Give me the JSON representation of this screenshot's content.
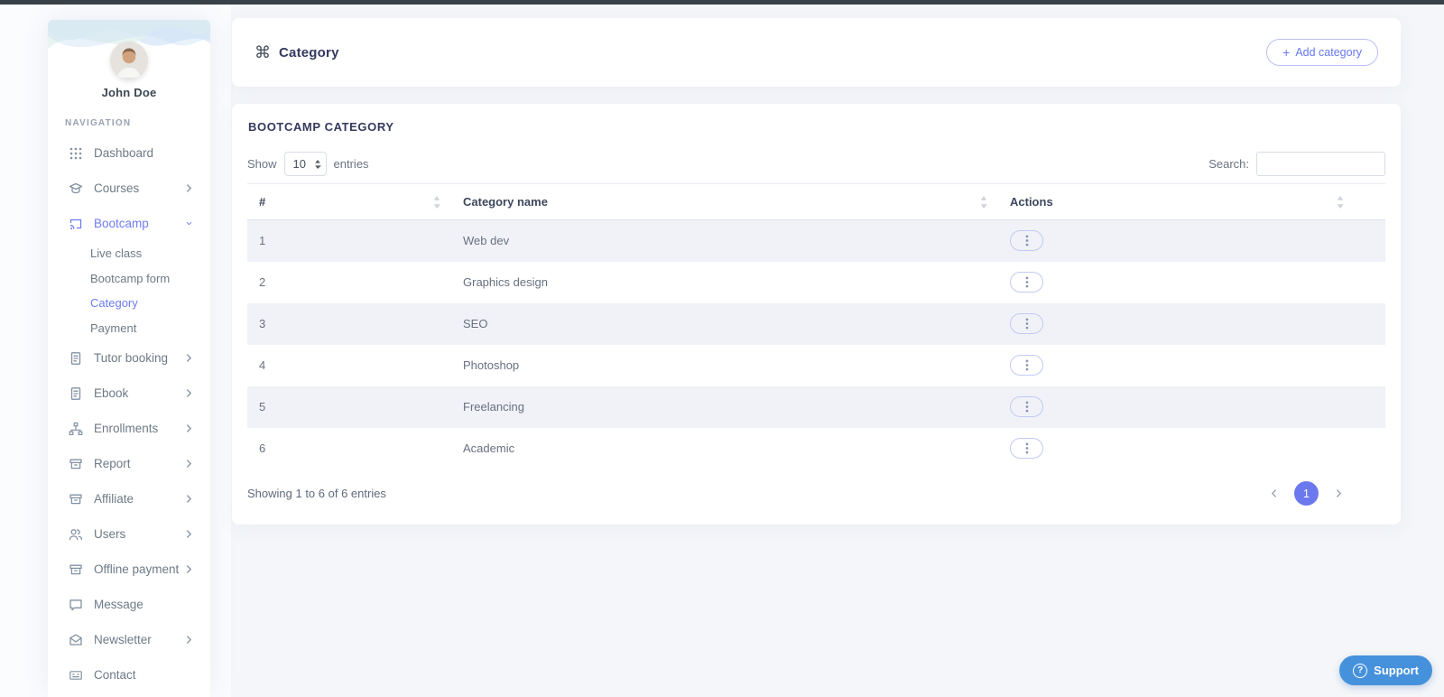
{
  "sidebar": {
    "user_name": "John Doe",
    "section_label": "NAVIGATION",
    "items": [
      {
        "label": "Dashboard",
        "icon": "grid-icon",
        "chevron": "none"
      },
      {
        "label": "Courses",
        "icon": "courses-icon",
        "chevron": "right"
      },
      {
        "label": "Bootcamp",
        "icon": "cast-icon",
        "chevron": "down",
        "active": true,
        "children": [
          {
            "label": "Live class"
          },
          {
            "label": "Bootcamp form"
          },
          {
            "label": "Category",
            "active": true
          },
          {
            "label": "Payment"
          }
        ]
      },
      {
        "label": "Tutor booking",
        "icon": "file-icon",
        "chevron": "right"
      },
      {
        "label": "Ebook",
        "icon": "file-icon",
        "chevron": "right"
      },
      {
        "label": "Enrollments",
        "icon": "sitemap-icon",
        "chevron": "right"
      },
      {
        "label": "Report",
        "icon": "tray-icon",
        "chevron": "right"
      },
      {
        "label": "Affiliate",
        "icon": "tray-icon",
        "chevron": "right"
      },
      {
        "label": "Users",
        "icon": "users-icon",
        "chevron": "right"
      },
      {
        "label": "Offline payment",
        "icon": "tray-icon",
        "chevron": "right"
      },
      {
        "label": "Message",
        "icon": "chat-icon",
        "chevron": "none"
      },
      {
        "label": "Newsletter",
        "icon": "envelope-icon",
        "chevron": "right"
      },
      {
        "label": "Contact",
        "icon": "idcard-icon",
        "chevron": "none"
      }
    ]
  },
  "header": {
    "icon": "command-icon",
    "title": "Category",
    "add_button_label": "Add category",
    "add_button_plus": "+"
  },
  "panel": {
    "title": "BOOTCAMP CATEGORY",
    "length_control": {
      "show_label": "Show",
      "value": "10",
      "entries_label": "entries"
    },
    "search": {
      "label": "Search:",
      "value": ""
    },
    "table": {
      "columns": [
        "#",
        "Category name",
        "Actions"
      ],
      "rows": [
        {
          "num": "1",
          "name": "Web dev"
        },
        {
          "num": "2",
          "name": "Graphics design"
        },
        {
          "num": "3",
          "name": "SEO"
        },
        {
          "num": "4",
          "name": "Photoshop"
        },
        {
          "num": "5",
          "name": "Freelancing"
        },
        {
          "num": "6",
          "name": "Academic"
        }
      ]
    },
    "footer": {
      "info": "Showing 1 to 6 of 6 entries",
      "current_page": "1"
    }
  },
  "support": {
    "label": "Support",
    "icon": "question-icon"
  },
  "colors": {
    "accent": "#6777ef",
    "pagination_active": "#6c78ee",
    "support_button": "#4691db",
    "row_stripe": "#f1f2f8",
    "topbar": "#394148",
    "page_bg": "#f4f6f9",
    "heading": "#34395e"
  }
}
